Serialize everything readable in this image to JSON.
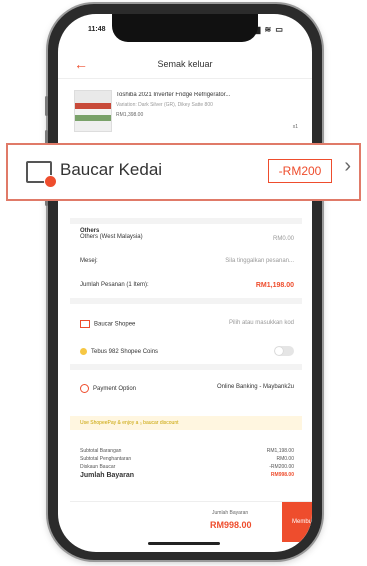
{
  "status_bar": {
    "time": "11:48",
    "icons": "▂▄▆ ≋ ▭"
  },
  "header": {
    "back_icon": "←",
    "title": "Semak keluar"
  },
  "product": {
    "name": "Toshiba 2021 Inverter Fridge Refrigerator...",
    "variant": "Variation: Dark Silver (GR), Dikey Satte 800",
    "price": "RM1,398.00",
    "quantity": "x1"
  },
  "voucher": {
    "label": "Baucar Kedai",
    "amount": "-RM200",
    "chevron": "›"
  },
  "shipping": {
    "label": "Others",
    "option": "Others (West Malaysia)",
    "price": "RM0.00"
  },
  "message": {
    "label": "Mesej:",
    "placeholder": "Sila tinggalkan pesanan..."
  },
  "order_total": {
    "label": "Jumlah Pesanan (1 Item):",
    "value": "RM1,198.00"
  },
  "shopee_voucher": {
    "label": "Baucar Shopee",
    "action": "Pilih atau masukkan kod"
  },
  "coins": {
    "label": "Tebus 982 Shopee Coins"
  },
  "payment": {
    "label": "Payment Option",
    "value": "Online Banking - Maybank2u"
  },
  "notice": "Use ShopeePay & enjoy a ₃ baucar discount",
  "summary": {
    "rows": [
      {
        "label": "Subtotal Barangan",
        "value": "RM1,198.00"
      },
      {
        "label": "Subtotal Penghantaran",
        "value": "RM0.00"
      },
      {
        "label": "Diskaun Baucar",
        "value": "-RM200.00"
      }
    ],
    "total_label": "Jumlah Bayaran",
    "total_value": "RM998.00"
  },
  "bottom_bar": {
    "total_label": "Jumlah Bayaran",
    "total_value": "RM998.00",
    "order_button": "Membuat pesanan"
  },
  "colors": {
    "accent": "#ee4d2d",
    "highlight_border": "#e07a68"
  }
}
